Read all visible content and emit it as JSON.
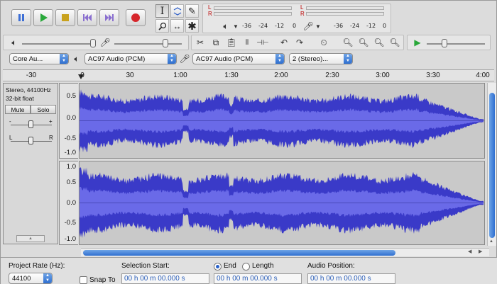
{
  "colors": {
    "wave": "#3a3ac8",
    "wave_rms": "#6a6ae8",
    "track_bg": "#c9c9c9",
    "accent": "#2f6fd0"
  },
  "transport": {
    "pause_icon": "pause-icon",
    "play_icon": "play-icon",
    "stop_icon": "stop-icon",
    "skip_start_icon": "skip-to-start-icon",
    "skip_end_icon": "skip-to-end-icon",
    "record_icon": "record-icon"
  },
  "tools": [
    "selection-tool",
    "envelope-tool",
    "draw-tool",
    "zoom-tool",
    "timeshift-tool",
    "multi-tool"
  ],
  "meters": {
    "play_left": "L",
    "play_right": "R",
    "rec_left": "L",
    "rec_right": "R",
    "scale_play": [
      "-36",
      "-24",
      "-12",
      "0"
    ],
    "scale_rec": [
      "-36",
      "-24",
      "-12",
      "0"
    ]
  },
  "devices": {
    "host": "Core Au...",
    "output": "AC97 Audio (PCM)",
    "input": "AC97 Audio (PCM)",
    "channels": "2 (Stereo)..."
  },
  "ruler": {
    "ticks": [
      "-30",
      "0",
      "30",
      "1:00",
      "1:30",
      "2:00",
      "2:30",
      "3:00",
      "3:30",
      "4:00"
    ]
  },
  "track": {
    "name": "Stereo, 44100Hz",
    "format": "32-bit float",
    "mute_label": "Mute",
    "solo_label": "Solo",
    "gain_minus": "-",
    "gain_plus": "+",
    "pan_left": "L",
    "pan_right": "R",
    "amp_labels_top": [
      "0.5",
      "0.0",
      "-0.5",
      "-1.0"
    ],
    "amp_labels_bottom": [
      "1.0",
      "0.5",
      "0.0",
      "-0.5",
      "-1.0"
    ]
  },
  "selection_toolbar": {
    "project_rate_label": "Project Rate (Hz):",
    "project_rate_value": "44100",
    "snap_to_label": "Snap To",
    "selection_start_label": "Selection Start:",
    "end_label": "End",
    "length_label": "Length",
    "audio_position_label": "Audio Position:",
    "selection_start_value": "00 h 00 m 00.000 s",
    "selection_end_value": "00 h 00 m 00.000 s",
    "audio_position_value": "00 h 00 m 00.000 s"
  }
}
